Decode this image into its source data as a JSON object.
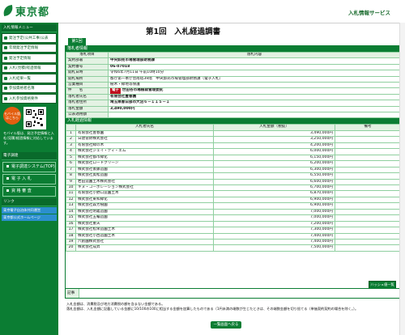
{
  "header": {
    "logo_text": "東京都",
    "service_name": "入札情報サービス"
  },
  "sidebar": {
    "section1_title": "入札情報メニュー",
    "items": [
      "発注予定(公共工事)公表",
      "年間発注予定情報",
      "発注予定情報",
      "入札(見積)経過情報",
      "入札結果一覧",
      "参加資格者名簿",
      "入札参加資格要件"
    ],
    "mobile_badge": "モバイル版 はこちら",
    "mobile_note": "モバイル版は、発注予定情報と入札(見積)経過情報に対応しています。",
    "section2_title": "電子調達",
    "sub_items": [
      "電子調達システム(TOP)",
      "電 子 入 札",
      "資 格 審 査"
    ],
    "section3_title": "リンク",
    "links": [
      "東京電子自治体共同運営",
      "東京都公式ホームページ"
    ]
  },
  "main": {
    "page_title": "第1回　入札経過調書",
    "round_tab": "第1回",
    "info_section_title": "落札者情報",
    "info_header": [
      "落札項目",
      "落札内容"
    ],
    "info_rows": [
      {
        "label": "契約部署",
        "value": "中央卸売市場管理部財務課"
      },
      {
        "label": "契約番号",
        "value": "06-07018"
      },
      {
        "label": "開札日時",
        "value": "令和6年7月11日 午前10時10分"
      },
      {
        "label": "開札場所",
        "value": "都庁第一本庁舎南塔39階　中央卸売市場管理部財務課（電子入札）"
      },
      {
        "label": "営業種目",
        "value": "樹木・緑地等保護"
      },
      {
        "label": "件　　名",
        "value": "世田谷市場植栽管理委託",
        "tag": "電子"
      },
      {
        "label": "落札者氏名",
        "value": "有限会社豊春園"
      },
      {
        "label": "落札者住所",
        "value": "埼玉県春日部市大沼６－１１５－１"
      },
      {
        "label": "落札金額",
        "value": "3,490,000円"
      },
      {
        "label": "公表適用額",
        "value": ""
      }
    ],
    "bid_section_title": "入札経過情報",
    "bid_header": [
      "入札者氏名",
      "入札金額（税抜）",
      "備考"
    ],
    "bids": [
      {
        "no": "1",
        "name": "有限会社豊春園",
        "amount": "3,490,000円",
        "note": ""
      },
      {
        "no": "2",
        "name": "日建管財株式会社",
        "amount": "3,250,000円",
        "note": ""
      },
      {
        "no": "3",
        "name": "有限会社緑の木",
        "amount": "4,200,000円",
        "note": ""
      },
      {
        "no": "4",
        "name": "株式会社ジェイ・ティ・エム",
        "amount": "6,000,000円",
        "note": ""
      },
      {
        "no": "5",
        "name": "株式会社都市緑化",
        "amount": "6,150,000円",
        "note": ""
      },
      {
        "no": "6",
        "name": "株式会社ロードクリーン",
        "amount": "6,200,000円",
        "note": ""
      },
      {
        "no": "7",
        "name": "株式会社後藤造園",
        "amount": "6,300,000円",
        "note": ""
      },
      {
        "no": "8",
        "name": "株式会社奥松造園",
        "amount": "6,550,000円",
        "note": ""
      },
      {
        "no": "9",
        "name": "岩田造園土木株式会社",
        "amount": "6,600,000円",
        "note": ""
      },
      {
        "no": "10",
        "name": "キヌ・コーポレーション株式会社",
        "amount": "6,700,000円",
        "note": ""
      },
      {
        "no": "11",
        "name": "有限会社小野口造園土木",
        "amount": "6,870,000円",
        "note": ""
      },
      {
        "no": "12",
        "name": "株式会社東和緑化",
        "amount": "6,900,000円",
        "note": ""
      },
      {
        "no": "13",
        "name": "株式会社森芳樹園",
        "amount": "6,900,000円",
        "note": ""
      },
      {
        "no": "14",
        "name": "株式会社明義造園",
        "amount": "7,000,000円",
        "note": ""
      },
      {
        "no": "15",
        "name": "株式会社五輪造園",
        "amount": "7,000,000円",
        "note": ""
      },
      {
        "no": "16",
        "name": "株式会社重天",
        "amount": "7,200,000円",
        "note": ""
      },
      {
        "no": "17",
        "name": "株式会社松栄造園土木",
        "amount": "7,300,000円",
        "note": ""
      },
      {
        "no": "18",
        "name": "株式会社小西造園土木",
        "amount": "7,400,000円",
        "note": ""
      },
      {
        "no": "19",
        "name": "六創園株式会社",
        "amount": "7,400,000円",
        "note": ""
      },
      {
        "no": "20",
        "name": "株式会社成昇",
        "amount": "7,500,000円",
        "note": ""
      }
    ],
    "history_button": "ハッシュ値一覧",
    "remarks_label": "記事",
    "remarks_value": "",
    "notes": [
      "入札金額は、消費税及び地方消費税の額を含まない金額である。",
      "落札金額は、入札金額に記載している金額に10/100の100に相当する金額を加算したものである（1円未満の端数が生じたときは、その端数金額を切り捨てる（単価契約契約の場合を除く。）。"
    ],
    "back_button": "一覧画面へ戻る"
  }
}
